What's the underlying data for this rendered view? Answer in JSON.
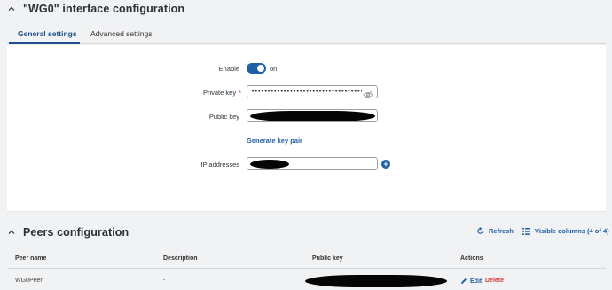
{
  "interface": {
    "title": "\"WG0\" interface configuration"
  },
  "tabs": [
    {
      "label": "General settings",
      "active": true
    },
    {
      "label": "Advanced settings",
      "active": false
    }
  ],
  "form": {
    "enable": {
      "label": "Enable",
      "state_text": "on",
      "checked": true
    },
    "private_key": {
      "label": "Private key",
      "required_mark": "*",
      "value": "••••••••••••••••••••••••••••••••••••••••••••"
    },
    "public_key": {
      "label": "Public key",
      "value": ""
    },
    "generate_link": "Generate key pair",
    "ip_addresses": {
      "label": "IP addresses",
      "value": ""
    }
  },
  "peers": {
    "title": "Peers configuration",
    "refresh_label": "Refresh",
    "columns_label": "Visible columns (4 of 4)",
    "headers": [
      "Peer name",
      "Description",
      "Public key",
      "Actions"
    ],
    "rows": [
      {
        "name": "WG0Peer",
        "description": "-",
        "public_key": "",
        "edit": "Edit",
        "delete": "Delete"
      }
    ]
  },
  "colors": {
    "accent": "#1f5fa6",
    "danger": "#d23b3b",
    "background": "#f1f2f4",
    "panel": "#ffffff"
  },
  "icons": [
    "chevron-up-icon",
    "eye-off-icon",
    "plus-icon",
    "refresh-icon",
    "columns-icon",
    "pencil-icon"
  ]
}
